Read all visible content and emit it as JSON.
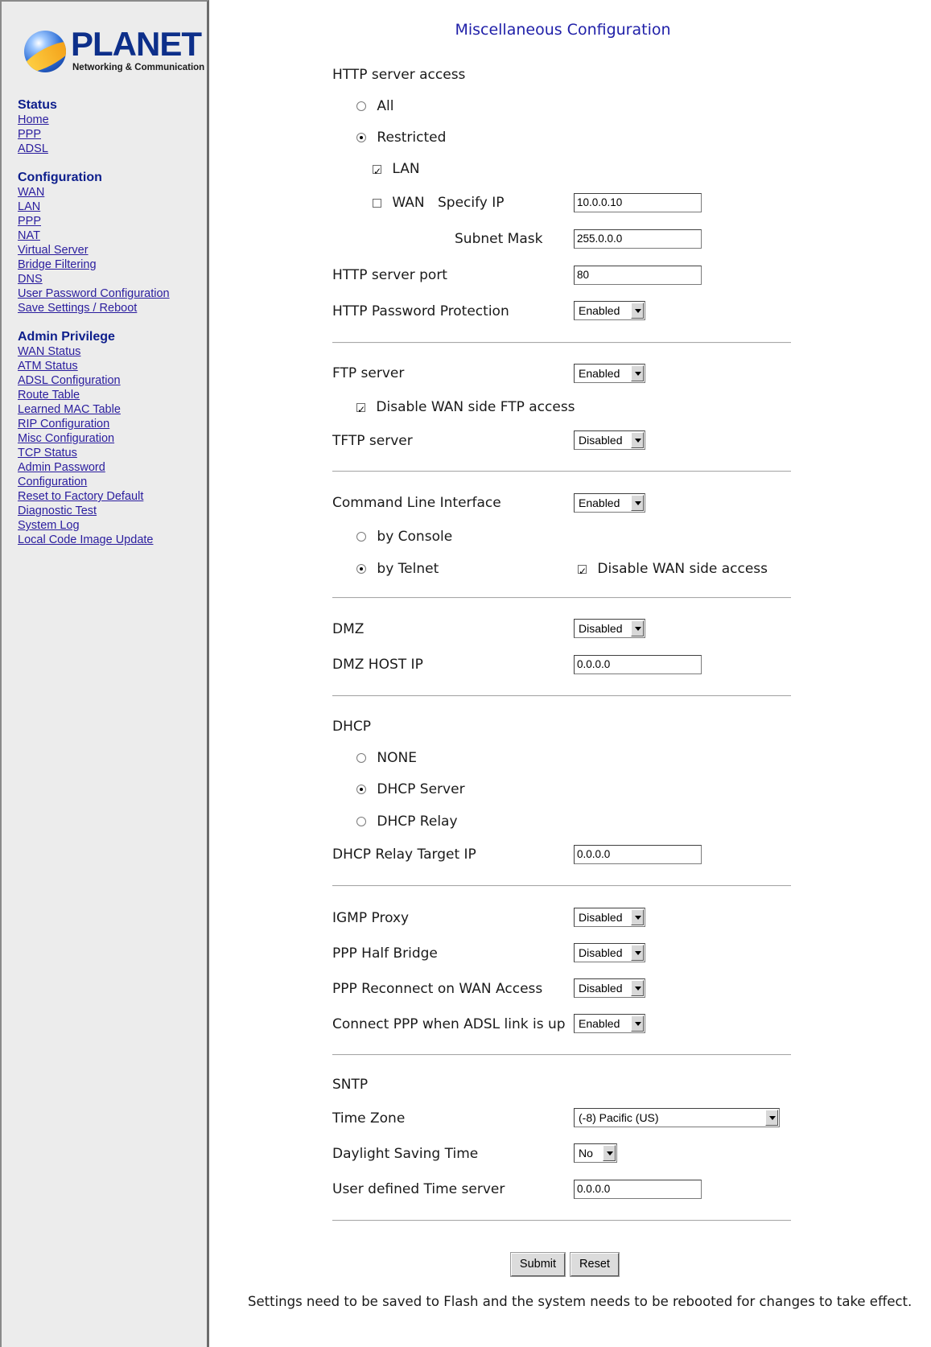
{
  "brand": {
    "name": "PLANET",
    "tagline": "Networking & Communication"
  },
  "sidebar": {
    "status": {
      "heading": "Status",
      "links": [
        "Home",
        "PPP",
        "ADSL"
      ]
    },
    "configuration": {
      "heading": "Configuration",
      "links": [
        "WAN",
        "LAN",
        "PPP",
        "NAT",
        "Virtual Server",
        "Bridge Filtering",
        "DNS",
        "User Password Configuration",
        "Save Settings / Reboot"
      ]
    },
    "admin": {
      "heading": "Admin Privilege",
      "links": [
        "WAN Status",
        "ATM Status",
        "ADSL Configuration",
        "Route Table",
        "Learned MAC Table",
        "RIP Configuration",
        "Misc Configuration",
        "TCP Status",
        "Admin Password",
        "Configuration",
        "Reset to Factory Default",
        "Diagnostic Test",
        "System Log",
        "Local Code Image Update"
      ]
    }
  },
  "page": {
    "title": "Miscellaneous Configuration"
  },
  "http": {
    "access_label": "HTTP server access",
    "all_label": "All",
    "restricted_label": "Restricted",
    "access_selected": "Restricted",
    "lan_label": "LAN",
    "lan_checked": true,
    "wan_label": "WAN",
    "wan_checked": false,
    "specify_ip_label": "Specify IP",
    "specify_ip_value": "10.0.0.10",
    "subnet_mask_label": "Subnet Mask",
    "subnet_mask_value": "255.0.0.0",
    "port_label": "HTTP server port",
    "port_value": "80",
    "password_label": "HTTP Password Protection",
    "password_value": "Enabled"
  },
  "ftp": {
    "server_label": "FTP server",
    "server_value": "Enabled",
    "disable_wan_label": "Disable WAN side FTP access",
    "disable_wan_checked": true,
    "tftp_label": "TFTP server",
    "tftp_value": "Disabled"
  },
  "cli": {
    "label": "Command Line Interface",
    "value": "Enabled",
    "console_label": "by Console",
    "telnet_label": "by Telnet",
    "selected": "by Telnet",
    "disable_wan_label": "Disable WAN side access",
    "disable_wan_checked": true
  },
  "dmz": {
    "label": "DMZ",
    "value": "Disabled",
    "host_ip_label": "DMZ HOST IP",
    "host_ip_value": "0.0.0.0"
  },
  "dhcp": {
    "label": "DHCP",
    "none_label": "NONE",
    "server_label": "DHCP Server",
    "relay_label": "DHCP Relay",
    "selected": "DHCP Server",
    "relay_target_label": "DHCP Relay Target IP",
    "relay_target_value": "0.0.0.0"
  },
  "misc": {
    "igmp_label": "IGMP Proxy",
    "igmp_value": "Disabled",
    "ppp_half_bridge_label": "PPP Half Bridge",
    "ppp_half_bridge_value": "Disabled",
    "ppp_reconnect_label": "PPP Reconnect on WAN Access",
    "ppp_reconnect_value": "Disabled",
    "connect_ppp_label": "Connect PPP when ADSL link is up",
    "connect_ppp_value": "Enabled"
  },
  "sntp": {
    "label": "SNTP",
    "timezone_label": "Time Zone",
    "timezone_value": "(-8) Pacific (US)",
    "dst_label": "Daylight Saving Time",
    "dst_value": "No",
    "time_server_label": "User defined Time server",
    "time_server_value": "0.0.0.0"
  },
  "actions": {
    "submit_label": "Submit",
    "reset_label": "Reset"
  },
  "footer": {
    "note": "Settings need to be saved to Flash and the system needs to be rebooted for changes to take effect."
  }
}
